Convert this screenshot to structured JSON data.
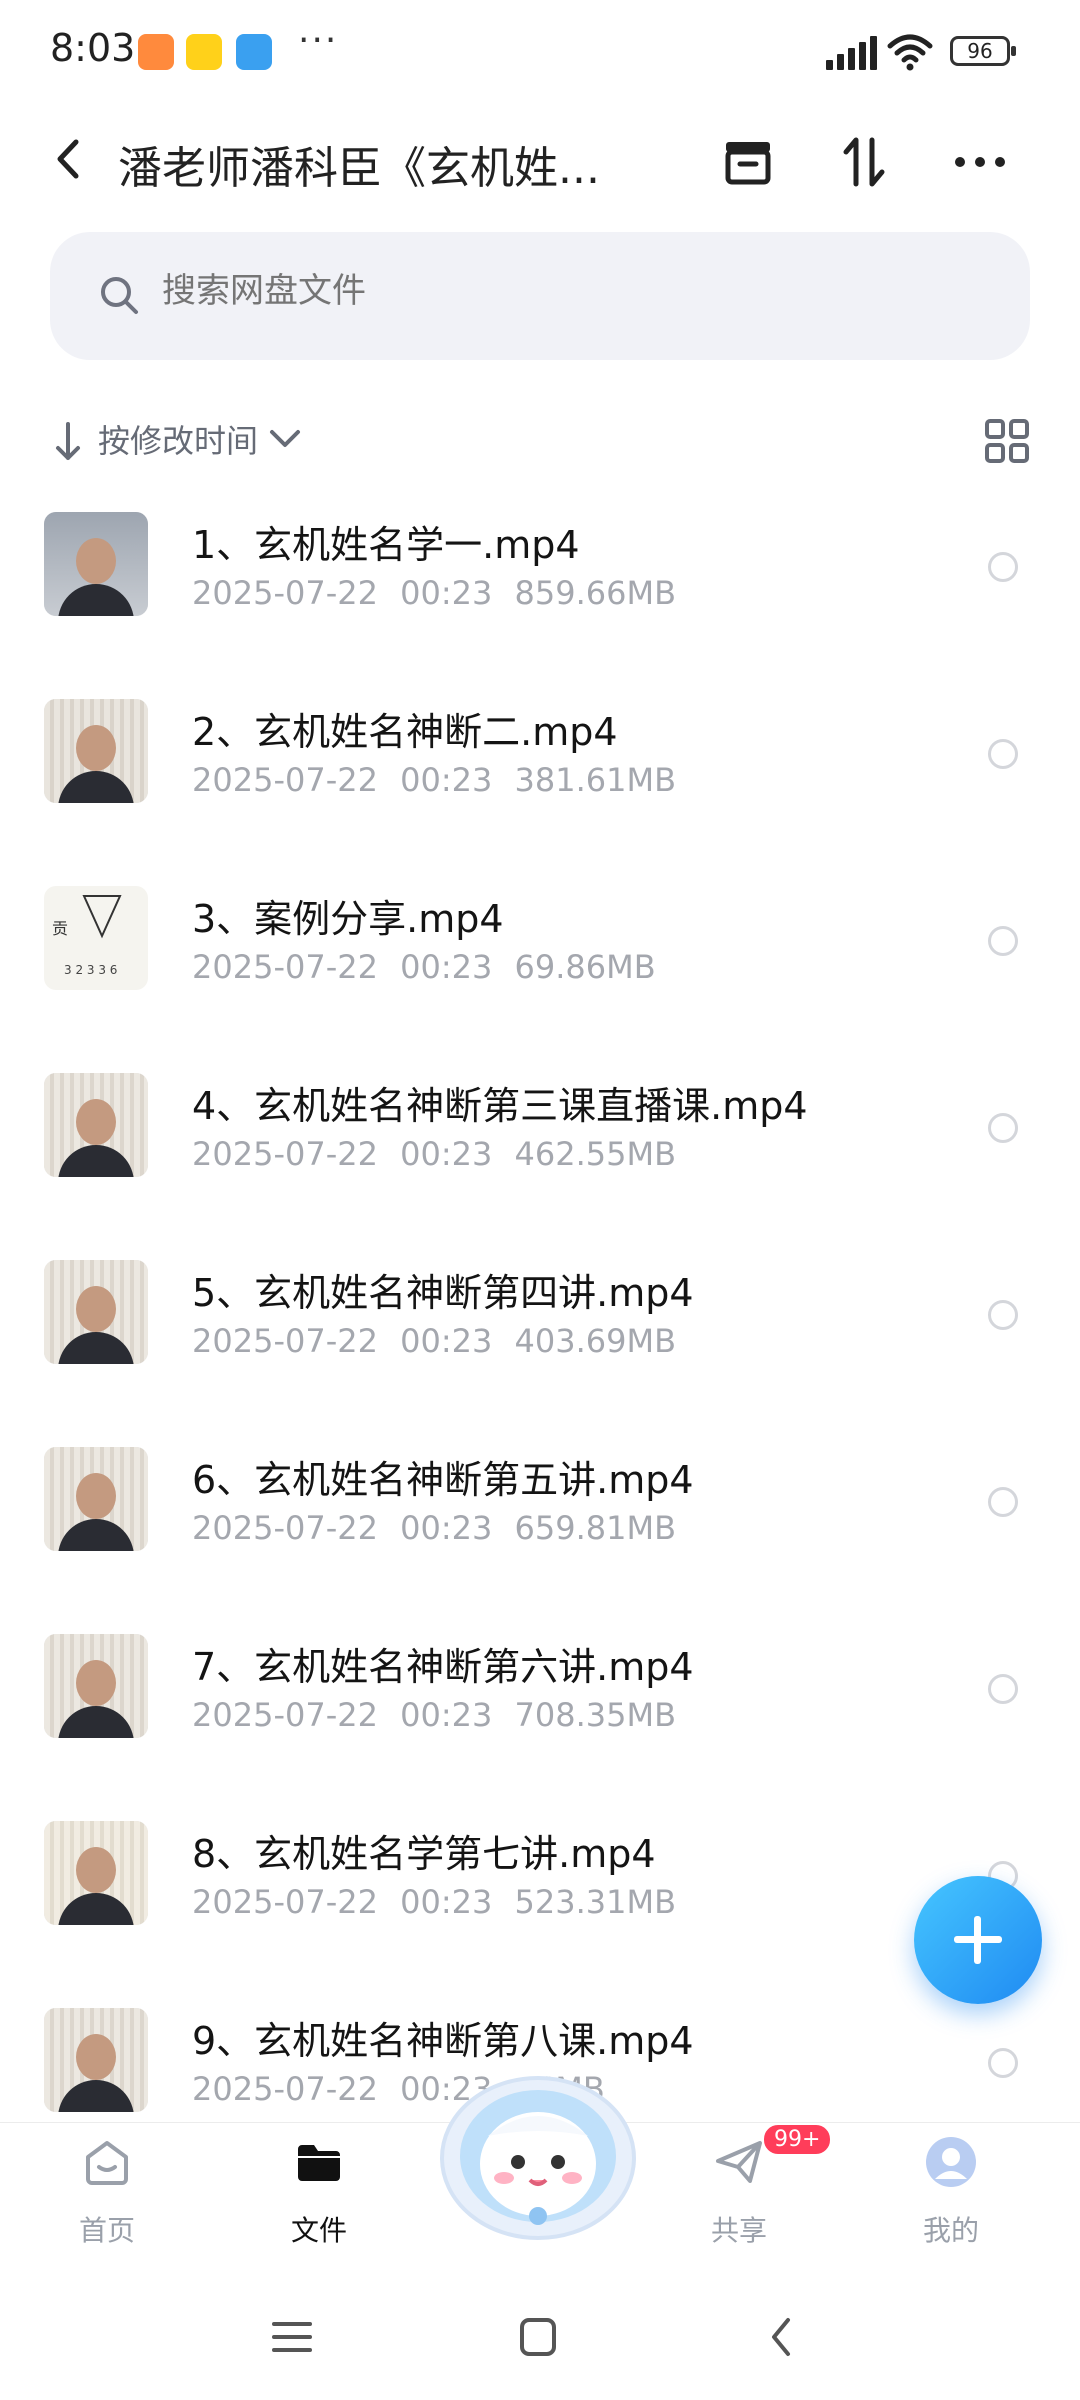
{
  "status_bar": {
    "time": "8:03",
    "battery": "96",
    "more": "···"
  },
  "header": {
    "title": "潘老师潘科臣《玄机姓..."
  },
  "search": {
    "placeholder": "搜索网盘文件"
  },
  "sort": {
    "label": "按修改时间"
  },
  "files": [
    {
      "name": "1、玄机姓名学一.mp4",
      "date": "2025-07-22",
      "time": "00:23",
      "size": "859.66MB"
    },
    {
      "name": "2、玄机姓名神断二.mp4",
      "date": "2025-07-22",
      "time": "00:23",
      "size": "381.61MB"
    },
    {
      "name": "3、案例分享.mp4",
      "date": "2025-07-22",
      "time": "00:23",
      "size": "69.86MB"
    },
    {
      "name": "4、玄机姓名神断第三课直播课.mp4",
      "date": "2025-07-22",
      "time": "00:23",
      "size": "462.55MB"
    },
    {
      "name": "5、玄机姓名神断第四讲.mp4",
      "date": "2025-07-22",
      "time": "00:23",
      "size": "403.69MB"
    },
    {
      "name": "6、玄机姓名神断第五讲.mp4",
      "date": "2025-07-22",
      "time": "00:23",
      "size": "659.81MB"
    },
    {
      "name": "7、玄机姓名神断第六讲.mp4",
      "date": "2025-07-22",
      "time": "00:23",
      "size": "708.35MB"
    },
    {
      "name": "8、玄机姓名学第七讲.mp4",
      "date": "2025-07-22",
      "time": "00:23",
      "size": "523.31MB"
    },
    {
      "name": "9、玄机姓名神断第八课.mp4",
      "date": "2025-07-22",
      "time": "00:23",
      "size": "..6MB"
    }
  ],
  "tabs": [
    {
      "label": "首页",
      "icon": "home-icon"
    },
    {
      "label": "文件",
      "icon": "folder-icon"
    },
    {
      "label": "共享",
      "icon": "paper-plane-icon",
      "badge": "99+"
    },
    {
      "label": "我的",
      "icon": "avatar-icon"
    }
  ],
  "colors": {
    "accent": "#1f8af2",
    "badge": "#ff3d5a",
    "meta_text": "#a4a7ae"
  }
}
